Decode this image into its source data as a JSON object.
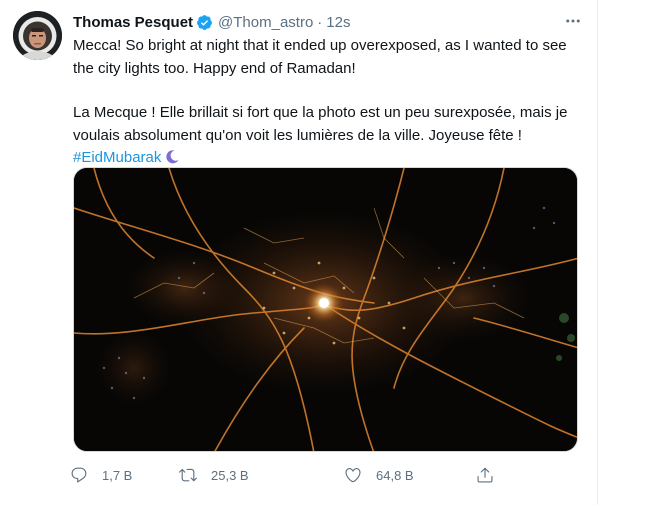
{
  "tweet": {
    "author_name": "Thomas Pesquet",
    "verified": true,
    "handle": "@Thom_astro",
    "separator": "·",
    "time": "12s",
    "text_en": "Mecca! So bright at night that it ended up overexposed, as I wanted to see the city lights too. Happy end of Ramadan!",
    "text_fr": "La Mecque ! Elle brillait si fort que la photo est un peu surexposée, mais je voulais absolument qu'on voit les lumières de la ville. Joyeuse fête !",
    "hashtag": "#EidMubarak",
    "emoji": "crescent-moon"
  },
  "actions": {
    "reply_count": "1,7 B",
    "retweet_count": "25,3 B",
    "like_count": "64,8 B"
  },
  "icons": {
    "verified": "verified-badge-icon",
    "more": "more-options-icon",
    "reply": "reply-icon",
    "retweet": "retweet-icon",
    "like": "heart-icon",
    "share": "share-icon"
  },
  "colors": {
    "text": "#0f1419",
    "secondary": "#5b7083",
    "link": "#1b95e0",
    "verified": "#1da1f2",
    "border": "#cfd9de"
  }
}
